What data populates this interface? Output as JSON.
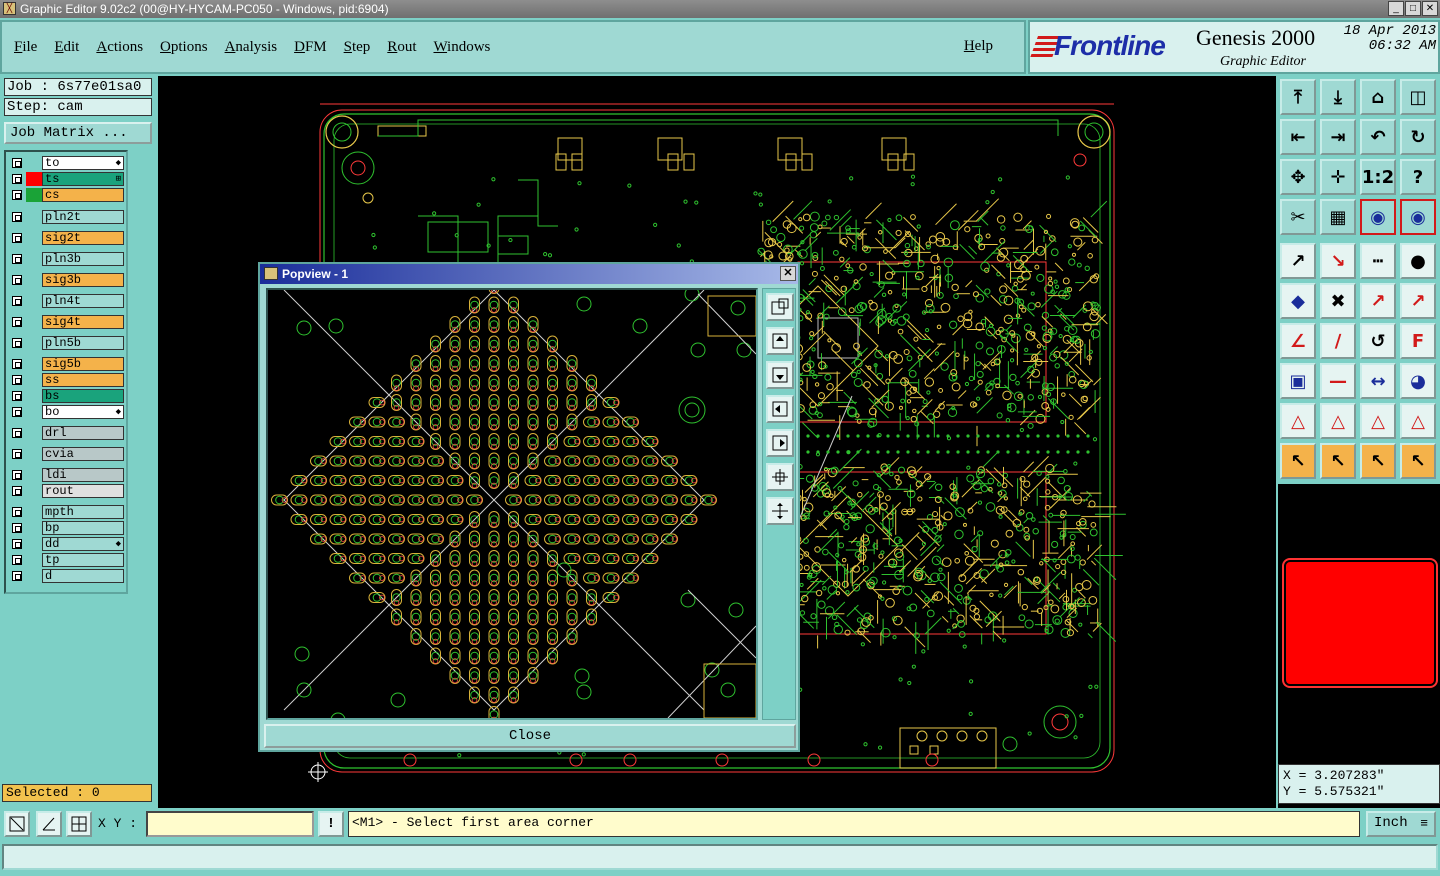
{
  "window": {
    "title": "Graphic Editor 9.02c2 (00@HY-HYCAM-PC050 - Windows, pid:6904)"
  },
  "menu": {
    "items": [
      "File",
      "Edit",
      "Actions",
      "Options",
      "Analysis",
      "DFM",
      "Step",
      "Rout",
      "Windows"
    ],
    "help": "Help"
  },
  "brand": {
    "logo": "Frontline",
    "product": "Genesis 2000",
    "subtitle": "Graphic Editor",
    "date": "18 Apr 2013",
    "time": "06:32 AM"
  },
  "job": {
    "job_line": "Job : 6s77e01sa0",
    "step_line": "Step: cam",
    "matrix_button": "Job Matrix ..."
  },
  "layers": [
    {
      "name": "to",
      "color": "#ffffff",
      "swatch": "",
      "mark": "◆"
    },
    {
      "name": "ts",
      "color": "#1aa37c",
      "swatch": "#ff0000",
      "mark": "⊞"
    },
    {
      "name": "cs",
      "color": "#f4b24a",
      "swatch": "#1aa337",
      "mark": ""
    },
    {
      "name": "pln2t",
      "color": "#9fd9d3",
      "swatch": "",
      "mark": ""
    },
    {
      "name": "sig2t",
      "color": "#f4b24a",
      "swatch": "",
      "mark": ""
    },
    {
      "name": "pln3b",
      "color": "#9fd9d3",
      "swatch": "",
      "mark": ""
    },
    {
      "name": "sig3b",
      "color": "#f4b24a",
      "swatch": "",
      "mark": ""
    },
    {
      "name": "pln4t",
      "color": "#9fd9d3",
      "swatch": "",
      "mark": ""
    },
    {
      "name": "sig4t",
      "color": "#f4b24a",
      "swatch": "",
      "mark": ""
    },
    {
      "name": "pln5b",
      "color": "#9fd9d3",
      "swatch": "",
      "mark": ""
    },
    {
      "name": "sig5b",
      "color": "#f4b24a",
      "swatch": "",
      "mark": ""
    },
    {
      "name": "ss",
      "color": "#f4b24a",
      "swatch": "",
      "mark": ""
    },
    {
      "name": "bs",
      "color": "#1aa37c",
      "swatch": "",
      "mark": ""
    },
    {
      "name": "bo",
      "color": "#ffffff",
      "swatch": "",
      "mark": "◆"
    },
    {
      "name": "drl",
      "color": "#b8c8c8",
      "swatch": "",
      "mark": ""
    },
    {
      "name": "cvia",
      "color": "#b8c8c8",
      "swatch": "",
      "mark": ""
    },
    {
      "name": "ldi",
      "color": "#b8c8c8",
      "swatch": "",
      "mark": ""
    },
    {
      "name": "rout",
      "color": "#e0e0e0",
      "swatch": "",
      "mark": ""
    },
    {
      "name": "mpth",
      "color": "#9fd9d3",
      "swatch": "",
      "mark": ""
    },
    {
      "name": "bp",
      "color": "#9fd9d3",
      "swatch": "",
      "mark": ""
    },
    {
      "name": "dd",
      "color": "#9fd9d3",
      "swatch": "",
      "mark": "◆"
    },
    {
      "name": "tp",
      "color": "#9fd9d3",
      "swatch": "",
      "mark": ""
    },
    {
      "name": "d",
      "color": "#9fd9d3",
      "swatch": "",
      "mark": ""
    }
  ],
  "selected": "Selected : 0",
  "popview": {
    "title": "Popview - 1",
    "close_label": "Close"
  },
  "coords": {
    "x": "X = 3.207283\"",
    "y": "Y = 5.575321\""
  },
  "bottom": {
    "xy_label": "X Y :",
    "xy_value": "",
    "message": "<M1> - Select first area corner",
    "unit": "Inch"
  },
  "colors": {
    "panel": "#7dd0c6",
    "canvas": "#000000",
    "green": "#1aa337",
    "orange": "#f4b24a",
    "red": "#ff0000"
  },
  "toolbar_icons": [
    "zoom-home-icon",
    "zoom-in-icon",
    "home-icon",
    "window-icon",
    "pan-left-icon",
    "pan-right-icon",
    "undo-icon",
    "redraw-icon",
    "fit-icon",
    "zoom-fit-icon",
    "one-to-two-icon",
    "help-icon",
    "measure-icon",
    "grid-icon",
    "layers-red-icon",
    "layers-red-2-icon",
    "add-pad-icon",
    "draw-line-icon",
    "ruler-icon",
    "dot-icon",
    "connect-icon",
    "cross-icon",
    "move-pad-icon",
    "move-pad-2-icon",
    "angle-icon",
    "line-icon",
    "arc-icon",
    "text-icon",
    "pads-icon",
    "line-red-icon",
    "dimension-icon",
    "circles-icon",
    "triangle-icon",
    "triangle-2-icon",
    "triangle-3-icon",
    "triangle-4-icon",
    "select-icon",
    "select-2-icon",
    "select-3-icon",
    "select-net-icon"
  ]
}
